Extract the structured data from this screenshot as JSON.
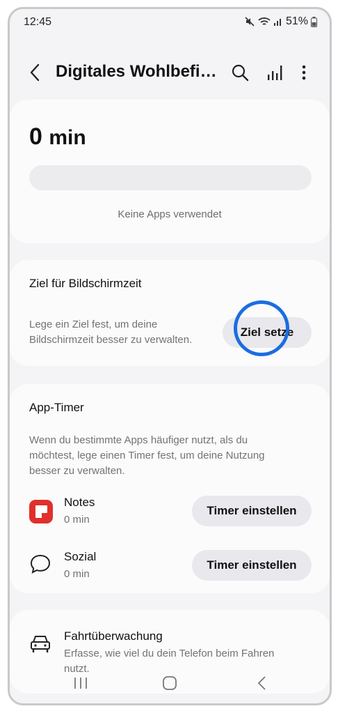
{
  "status": {
    "time": "12:45",
    "battery": "51%"
  },
  "header": {
    "title": "Digitales Wohlbefi…"
  },
  "usage": {
    "value": "0",
    "unit": "min",
    "empty_text": "Keine Apps verwendet"
  },
  "goal": {
    "title": "Ziel für Bildschirmzeit",
    "desc_line1": "Lege ein Ziel fest, um deine",
    "desc_line2": "Bildschirmzeit besser zu verwalten.",
    "button_label": "Ziel setze"
  },
  "app_timer": {
    "title": "App-Timer",
    "desc_line1": "Wenn du bestimmte Apps häufiger nutzt, als du",
    "desc_line2": "möchtest, lege einen Timer fest, um deine Nutzung",
    "desc_line3": "besser zu verwalten.",
    "apps": [
      {
        "name": "Notes",
        "time": "0 min",
        "button": "Timer einstellen",
        "icon": "notes-app-icon"
      },
      {
        "name": "Sozial",
        "time": "0 min",
        "button": "Timer einstellen",
        "icon": "chat-bubble-icon"
      }
    ]
  },
  "driving": {
    "title": "Fahrtüberwachung",
    "desc_line1": "Erfasse, wie viel du dein Telefon beim Fahren",
    "desc_line2": "nutzt."
  },
  "colors": {
    "accent_ring": "#1b6de0",
    "notes_red": "#e0302b"
  }
}
